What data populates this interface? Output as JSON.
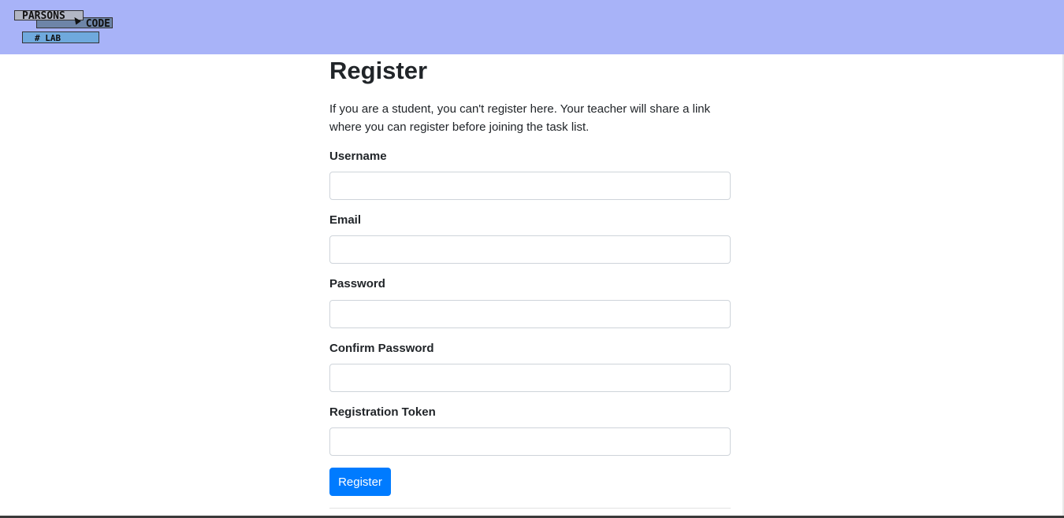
{
  "header": {
    "logo": {
      "line1": "PARSONS",
      "line2": "CODE",
      "line3": "# LAB"
    },
    "background_color": "#a8b3f8"
  },
  "page": {
    "title": "Register",
    "intro": "If you are a student, you can't register here. Your teacher will share a link where you can register before joining the task list."
  },
  "form": {
    "fields": [
      {
        "label": "Username",
        "value": "",
        "placeholder": ""
      },
      {
        "label": "Email",
        "value": "",
        "placeholder": ""
      },
      {
        "label": "Password",
        "value": "",
        "placeholder": ""
      },
      {
        "label": "Confirm Password",
        "value": "",
        "placeholder": ""
      },
      {
        "label": "Registration Token",
        "value": "",
        "placeholder": ""
      }
    ],
    "submit_label": "Register",
    "submit_color": "#007bff"
  }
}
